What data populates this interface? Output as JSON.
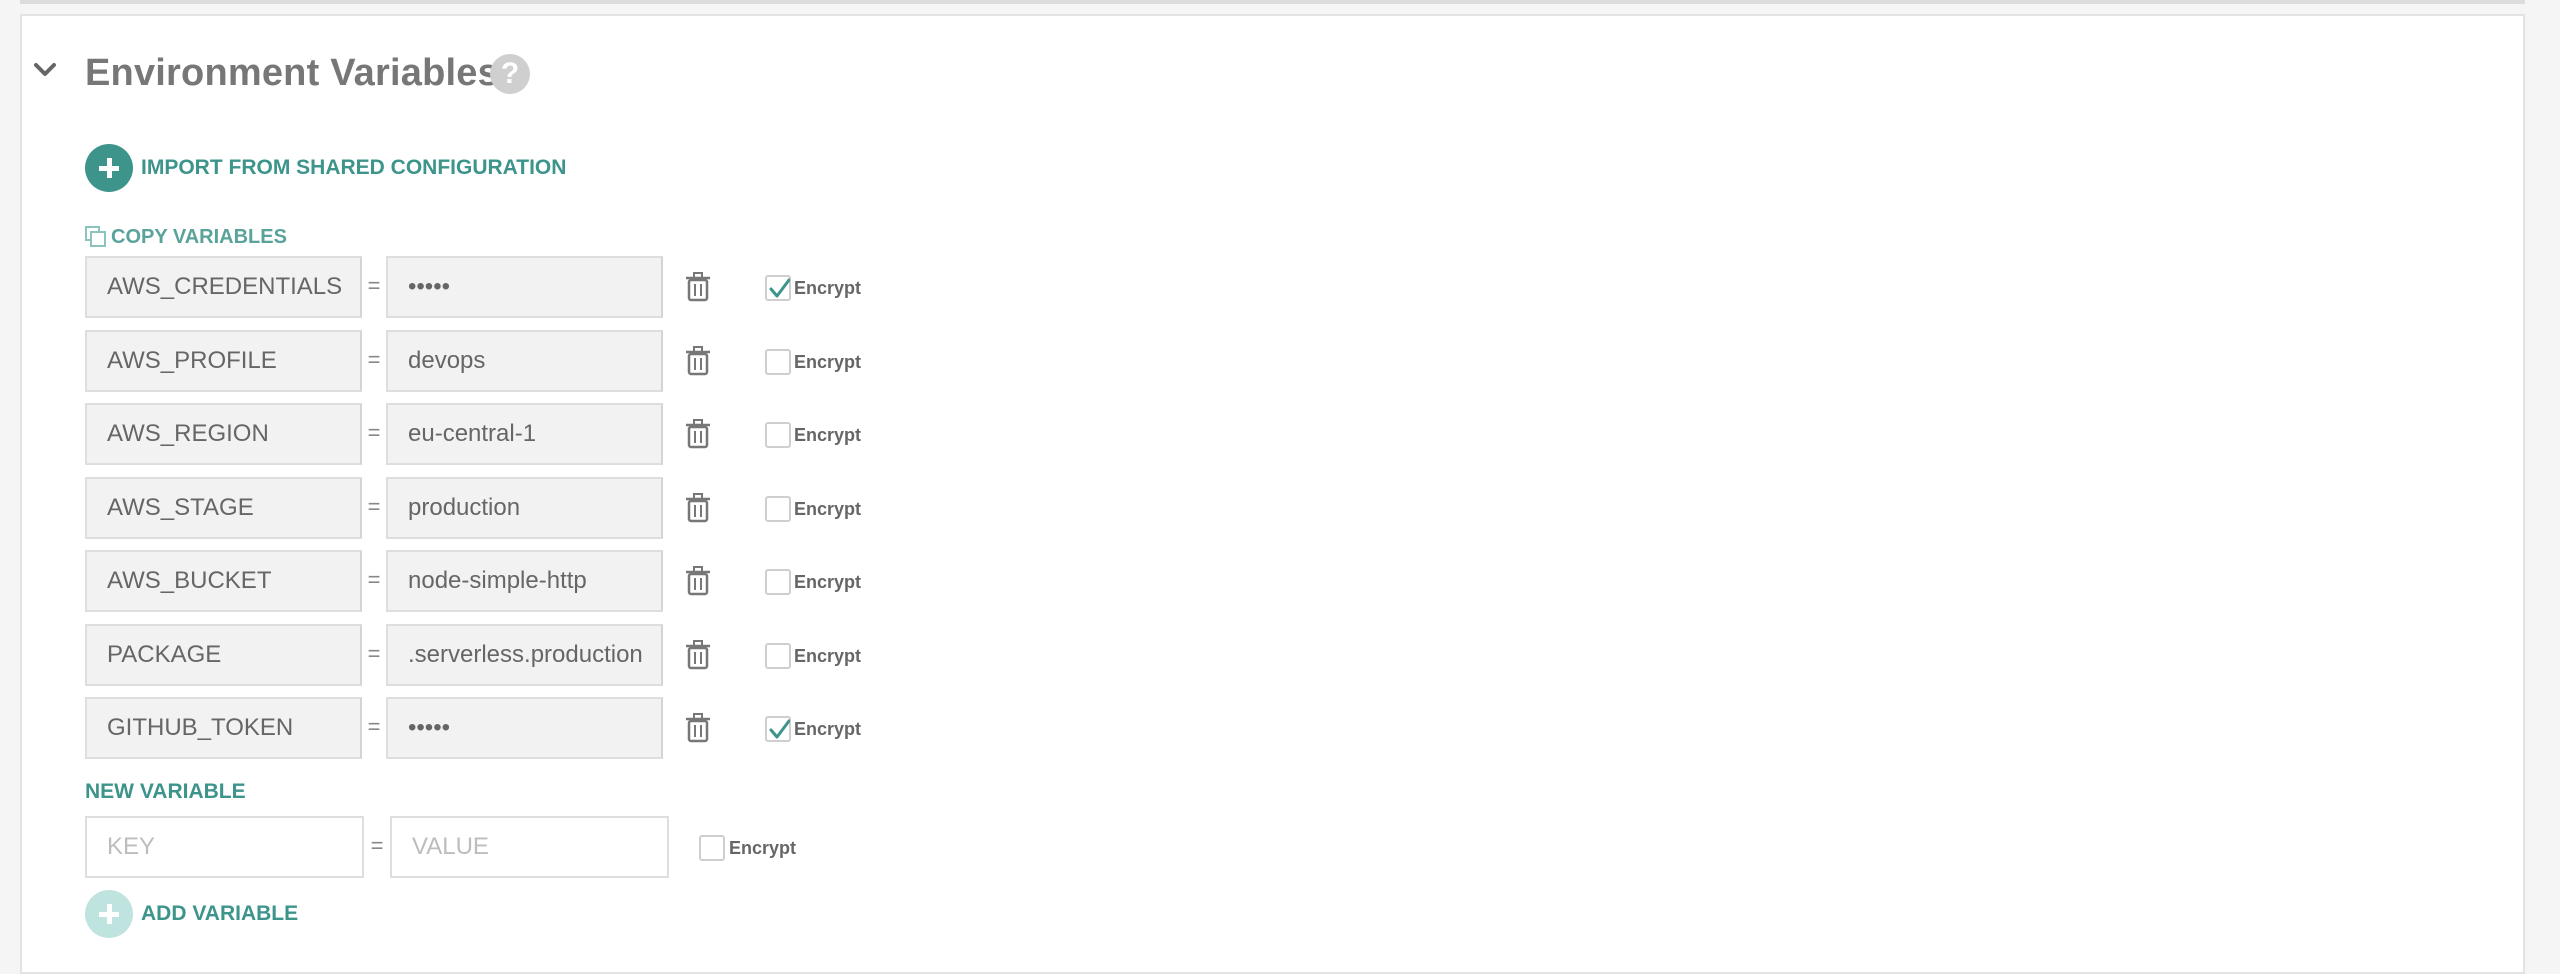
{
  "section": {
    "title": "Environment Variables",
    "help_glyph": "?"
  },
  "actions": {
    "import_label": "IMPORT FROM SHARED CONFIGURATION",
    "copy_label": "COPY VARIABLES",
    "new_variable_label": "NEW VARIABLE",
    "add_variable_label": "ADD VARIABLE"
  },
  "variables": [
    {
      "key": "AWS_CREDENTIALS",
      "value": "•••••",
      "encrypted": true
    },
    {
      "key": "AWS_PROFILE",
      "value": "devops",
      "encrypted": false
    },
    {
      "key": "AWS_REGION",
      "value": "eu-central-1",
      "encrypted": false
    },
    {
      "key": "AWS_STAGE",
      "value": "production",
      "encrypted": false
    },
    {
      "key": "AWS_BUCKET",
      "value": "node-simple-http",
      "encrypted": false
    },
    {
      "key": "PACKAGE",
      "value": ".serverless.production",
      "encrypted": false
    },
    {
      "key": "GITHUB_TOKEN",
      "value": "•••••",
      "encrypted": true
    }
  ],
  "equals_sign": "=",
  "encrypt_label": "Encrypt",
  "new_variable": {
    "key_placeholder": "KEY",
    "value_placeholder": "VALUE",
    "encrypted": false
  },
  "colors": {
    "accent": "#3c948b",
    "accent_light": "#bfe3df"
  },
  "icons": {
    "collapse": "chevron-down-icon",
    "help": "question-circle-icon",
    "import": "plus-circle-icon",
    "copy": "copy-icon",
    "delete": "trash-icon",
    "checked": "check-icon"
  }
}
